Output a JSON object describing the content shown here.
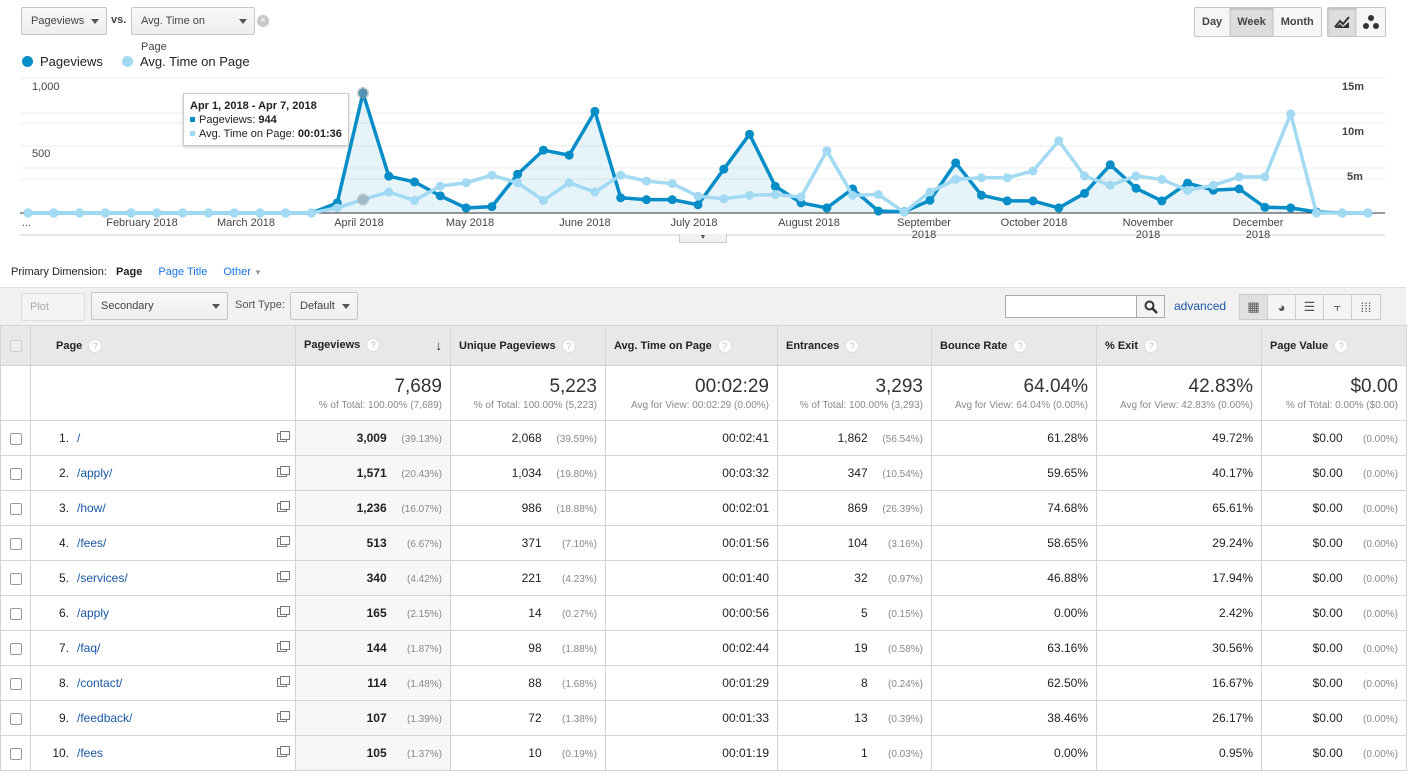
{
  "controls": {
    "metric1": "Pageviews",
    "vs": "vs.",
    "metric2": "Avg. Time on Page",
    "periods": [
      "Day",
      "Week",
      "Month"
    ],
    "active_period": "Week"
  },
  "legend": [
    {
      "name": "Pageviews",
      "color": "#058dc7"
    },
    {
      "name": "Avg. Time on Page",
      "color": "#a1daf2"
    }
  ],
  "tooltip": {
    "range": "Apr 1, 2018 - Apr 7, 2018",
    "pv_label": "Pageviews:",
    "pv_value": "944",
    "time_label": "Avg. Time on Page:",
    "time_value": "00:01:36"
  },
  "chart_data": {
    "type": "line",
    "x_tick_labels": [
      "...",
      "February 2018",
      "March 2018",
      "April 2018",
      "May 2018",
      "June 2018",
      "July 2018",
      "August 2018",
      "September 2018",
      "October 2018",
      "November 2018",
      "December 2018"
    ],
    "y_left": {
      "ticks": [
        "500",
        "1,000"
      ],
      "range": [
        0,
        1000
      ]
    },
    "y_right": {
      "ticks": [
        "5m",
        "10m",
        "15m"
      ],
      "range": [
        0,
        15
      ],
      "unit": "minutes"
    },
    "grid": true,
    "series": [
      {
        "name": "Pageviews",
        "axis": "left",
        "color": "#058dc7",
        "values": [
          0,
          0,
          0,
          0,
          0,
          0,
          0,
          0,
          0,
          0,
          0,
          0,
          80,
          944,
          290,
          245,
          135,
          40,
          50,
          305,
          495,
          455,
          800,
          120,
          105,
          105,
          65,
          345,
          620,
          210,
          80,
          40,
          190,
          15,
          10,
          100,
          395,
          140,
          95,
          95,
          40,
          155,
          380,
          195,
          95,
          235,
          180,
          190,
          45,
          40,
          8,
          0,
          0
        ]
      },
      {
        "name": "Avg. Time on Page",
        "axis": "right",
        "color": "#a1daf2",
        "values": [
          0,
          0,
          0,
          0,
          0,
          0,
          0,
          0,
          0,
          0,
          0,
          0,
          0.6,
          1.6,
          2.5,
          1.5,
          3.2,
          3.6,
          4.5,
          3.6,
          1.5,
          3.6,
          2.5,
          4.5,
          3.8,
          3.5,
          2.0,
          1.7,
          2.1,
          2.2,
          1.9,
          7.4,
          2.1,
          2.2,
          0.1,
          2.5,
          4.0,
          4.2,
          4.2,
          5.0,
          8.6,
          4.4,
          3.3,
          4.4,
          4.0,
          2.7,
          3.3,
          4.3,
          4.3,
          11.8,
          0,
          0,
          0
        ]
      }
    ]
  },
  "dimension": {
    "label": "Primary Dimension:",
    "active": "Page",
    "options": [
      "Page Title",
      "Other"
    ]
  },
  "toolbar": {
    "plot_rows": "Plot Rows",
    "secondary": "Secondary dimension",
    "sort_label": "Sort Type:",
    "sort_value": "Default",
    "search_placeholder": "",
    "advanced": "advanced"
  },
  "table": {
    "headers": [
      "Page",
      "Pageviews",
      "Unique Pageviews",
      "Avg. Time on Page",
      "Entrances",
      "Bounce Rate",
      "% Exit",
      "Page Value"
    ],
    "totals": [
      {
        "big": "7,689",
        "small": "% of Total: 100.00% (7,689)"
      },
      {
        "big": "5,223",
        "small": "% of Total: 100.00% (5,223)"
      },
      {
        "big": "00:02:29",
        "small": "Avg for View: 00:02:29 (0.00%)"
      },
      {
        "big": "3,293",
        "small": "% of Total: 100.00% (3,293)"
      },
      {
        "big": "64.04%",
        "small": "Avg for View: 64.04% (0.00%)"
      },
      {
        "big": "42.83%",
        "small": "Avg for View: 42.83% (0.00%)"
      },
      {
        "big": "$0.00",
        "small": "% of Total: 0.00% ($0.00)"
      }
    ],
    "rows": [
      {
        "n": "1.",
        "page": "/",
        "pv": "3,009",
        "pvp": "(39.13%)",
        "upv": "2,068",
        "upvp": "(39.59%)",
        "time": "00:02:41",
        "ent": "1,862",
        "entp": "(56.54%)",
        "bounce": "61.28%",
        "exit": "49.72%",
        "val": "$0.00",
        "valp": "(0.00%)"
      },
      {
        "n": "2.",
        "page": "/apply/",
        "pv": "1,571",
        "pvp": "(20.43%)",
        "upv": "1,034",
        "upvp": "(19.80%)",
        "time": "00:03:32",
        "ent": "347",
        "entp": "(10.54%)",
        "bounce": "59.65%",
        "exit": "40.17%",
        "val": "$0.00",
        "valp": "(0.00%)"
      },
      {
        "n": "3.",
        "page": "/how/",
        "pv": "1,236",
        "pvp": "(16.07%)",
        "upv": "986",
        "upvp": "(18.88%)",
        "time": "00:02:01",
        "ent": "869",
        "entp": "(26.39%)",
        "bounce": "74.68%",
        "exit": "65.61%",
        "val": "$0.00",
        "valp": "(0.00%)"
      },
      {
        "n": "4.",
        "page": "/fees/",
        "pv": "513",
        "pvp": "(6.67%)",
        "upv": "371",
        "upvp": "(7.10%)",
        "time": "00:01:56",
        "ent": "104",
        "entp": "(3.16%)",
        "bounce": "58.65%",
        "exit": "29.24%",
        "val": "$0.00",
        "valp": "(0.00%)"
      },
      {
        "n": "5.",
        "page": "/services/",
        "pv": "340",
        "pvp": "(4.42%)",
        "upv": "221",
        "upvp": "(4.23%)",
        "time": "00:01:40",
        "ent": "32",
        "entp": "(0.97%)",
        "bounce": "46.88%",
        "exit": "17.94%",
        "val": "$0.00",
        "valp": "(0.00%)"
      },
      {
        "n": "6.",
        "page": "/apply",
        "pv": "165",
        "pvp": "(2.15%)",
        "upv": "14",
        "upvp": "(0.27%)",
        "time": "00:00:56",
        "ent": "5",
        "entp": "(0.15%)",
        "bounce": "0.00%",
        "exit": "2.42%",
        "val": "$0.00",
        "valp": "(0.00%)"
      },
      {
        "n": "7.",
        "page": "/faq/",
        "pv": "144",
        "pvp": "(1.87%)",
        "upv": "98",
        "upvp": "(1.88%)",
        "time": "00:02:44",
        "ent": "19",
        "entp": "(0.58%)",
        "bounce": "63.16%",
        "exit": "30.56%",
        "val": "$0.00",
        "valp": "(0.00%)"
      },
      {
        "n": "8.",
        "page": "/contact/",
        "pv": "114",
        "pvp": "(1.48%)",
        "upv": "88",
        "upvp": "(1.68%)",
        "time": "00:01:29",
        "ent": "8",
        "entp": "(0.24%)",
        "bounce": "62.50%",
        "exit": "16.67%",
        "val": "$0.00",
        "valp": "(0.00%)"
      },
      {
        "n": "9.",
        "page": "/feedback/",
        "pv": "107",
        "pvp": "(1.39%)",
        "upv": "72",
        "upvp": "(1.38%)",
        "time": "00:01:33",
        "ent": "13",
        "entp": "(0.39%)",
        "bounce": "38.46%",
        "exit": "26.17%",
        "val": "$0.00",
        "valp": "(0.00%)"
      },
      {
        "n": "10.",
        "page": "/fees",
        "pv": "105",
        "pvp": "(1.37%)",
        "upv": "10",
        "upvp": "(0.19%)",
        "time": "00:01:19",
        "ent": "1",
        "entp": "(0.03%)",
        "bounce": "0.00%",
        "exit": "0.95%",
        "val": "$0.00",
        "valp": "(0.00%)"
      }
    ]
  }
}
